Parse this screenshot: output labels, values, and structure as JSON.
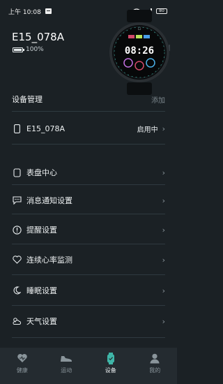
{
  "status_bar": {
    "time": "上午 10:08",
    "battery": "80"
  },
  "device": {
    "name": "E15_078A",
    "battery": "100%"
  },
  "watch_face": {
    "time": "08:26"
  },
  "section": {
    "title": "设备管理",
    "add": "添加"
  },
  "device_row": {
    "name": "E15_078A",
    "status": "启用中"
  },
  "menu": [
    {
      "label": "表盘中心",
      "icon": "watch-icon"
    },
    {
      "label": "消息通知设置",
      "icon": "message-icon"
    },
    {
      "label": "提醒设置",
      "icon": "alert-icon"
    },
    {
      "label": "连续心率监测",
      "icon": "heart-icon"
    },
    {
      "label": "睡眠设置",
      "icon": "moon-icon"
    },
    {
      "label": "天气设置",
      "icon": "weather-icon"
    }
  ],
  "tabs": [
    {
      "label": "健康",
      "icon": "health-icon",
      "active": false
    },
    {
      "label": "运动",
      "icon": "shoe-icon",
      "active": false
    },
    {
      "label": "设备",
      "icon": "device-watch-icon",
      "active": true
    },
    {
      "label": "我的",
      "icon": "profile-icon",
      "active": false
    }
  ],
  "colors": {
    "background": "#1b2125",
    "tabbar": "#242b30",
    "active_tab": "#3fb6a8"
  }
}
